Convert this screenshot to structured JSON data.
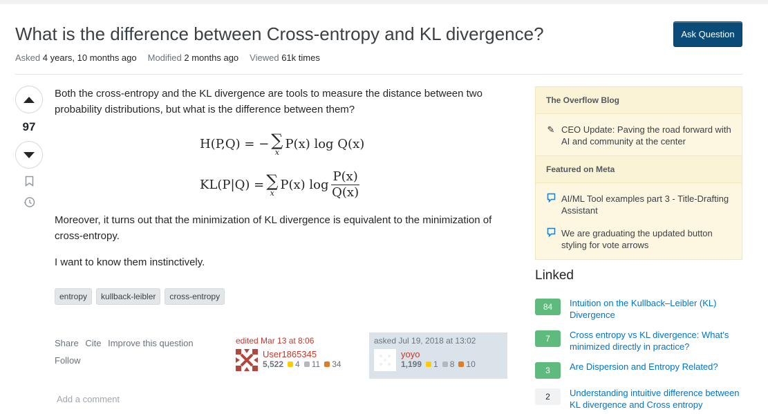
{
  "question": {
    "title": "What is the difference between Cross-entropy and KL divergence?",
    "asked_label": "Asked",
    "asked_value": "4 years, 10 months ago",
    "modified_label": "Modified",
    "modified_value": "2 months ago",
    "viewed_label": "Viewed",
    "viewed_value": "61k times",
    "ask_button": "Ask Question",
    "votes": "97",
    "body_p1": "Both the cross-entropy and the KL divergence are tools to measure the distance between two probability distributions, but what is the difference between them?",
    "eq1_lhs": "H(P,Q) = −",
    "eq1_rhs": "P(x) log Q(x)",
    "eq2_lhs": "KL(P|Q) =",
    "eq2_mid": "P(x) log",
    "eq2_num": "P(x)",
    "eq2_den": "Q(x)",
    "sum_sub": "x",
    "body_p2": "Moreover, it turns out that the minimization of KL divergence is equivalent to the minimization of cross-entropy.",
    "body_p3": "I want to know them instinctively.",
    "tags": [
      "entropy",
      "kullback-leibler",
      "cross-entropy"
    ]
  },
  "actions": {
    "share": "Share",
    "cite": "Cite",
    "improve": "Improve this question",
    "follow": "Follow",
    "add_comment": "Add a comment"
  },
  "editor": {
    "title": "edited Mar 13 at 8:06",
    "name": "User1865345",
    "rep": "5,522",
    "gold": "4",
    "silver": "11",
    "bronze": "34"
  },
  "asker": {
    "title": "asked Jul 19, 2018 at 13:02",
    "name": "yoyo",
    "rep": "1,199",
    "gold": "1",
    "silver": "8",
    "bronze": "10"
  },
  "sidebar": {
    "blog_head": "The Overflow Blog",
    "blog_items": [
      "CEO Update: Paving the road forward with AI and community at the center"
    ],
    "meta_head": "Featured on Meta",
    "meta_items": [
      "AI/ML Tool examples part 3 - Title-Drafting Assistant",
      "We are graduating the updated button styling for vote arrows"
    ]
  },
  "linked": {
    "heading": "Linked",
    "items": [
      {
        "score": "84",
        "text": "Intuition on the Kullback–Leibler (KL) Divergence",
        "accepted": true
      },
      {
        "score": "7",
        "text": "Cross entropy vs KL divergence: What's minimized directly in practice?",
        "accepted": true
      },
      {
        "score": "3",
        "text": "Are Dispersion and Entropy Related?",
        "accepted": true
      },
      {
        "score": "2",
        "text": "Understanding intuitive difference between KL divergence and Cross entropy",
        "accepted": false
      }
    ]
  },
  "colors": {
    "accent": "#0a4b78",
    "link": "#0074cc",
    "accepted": "#5eba7d",
    "sidebar_bg": "#fdf7e2"
  }
}
